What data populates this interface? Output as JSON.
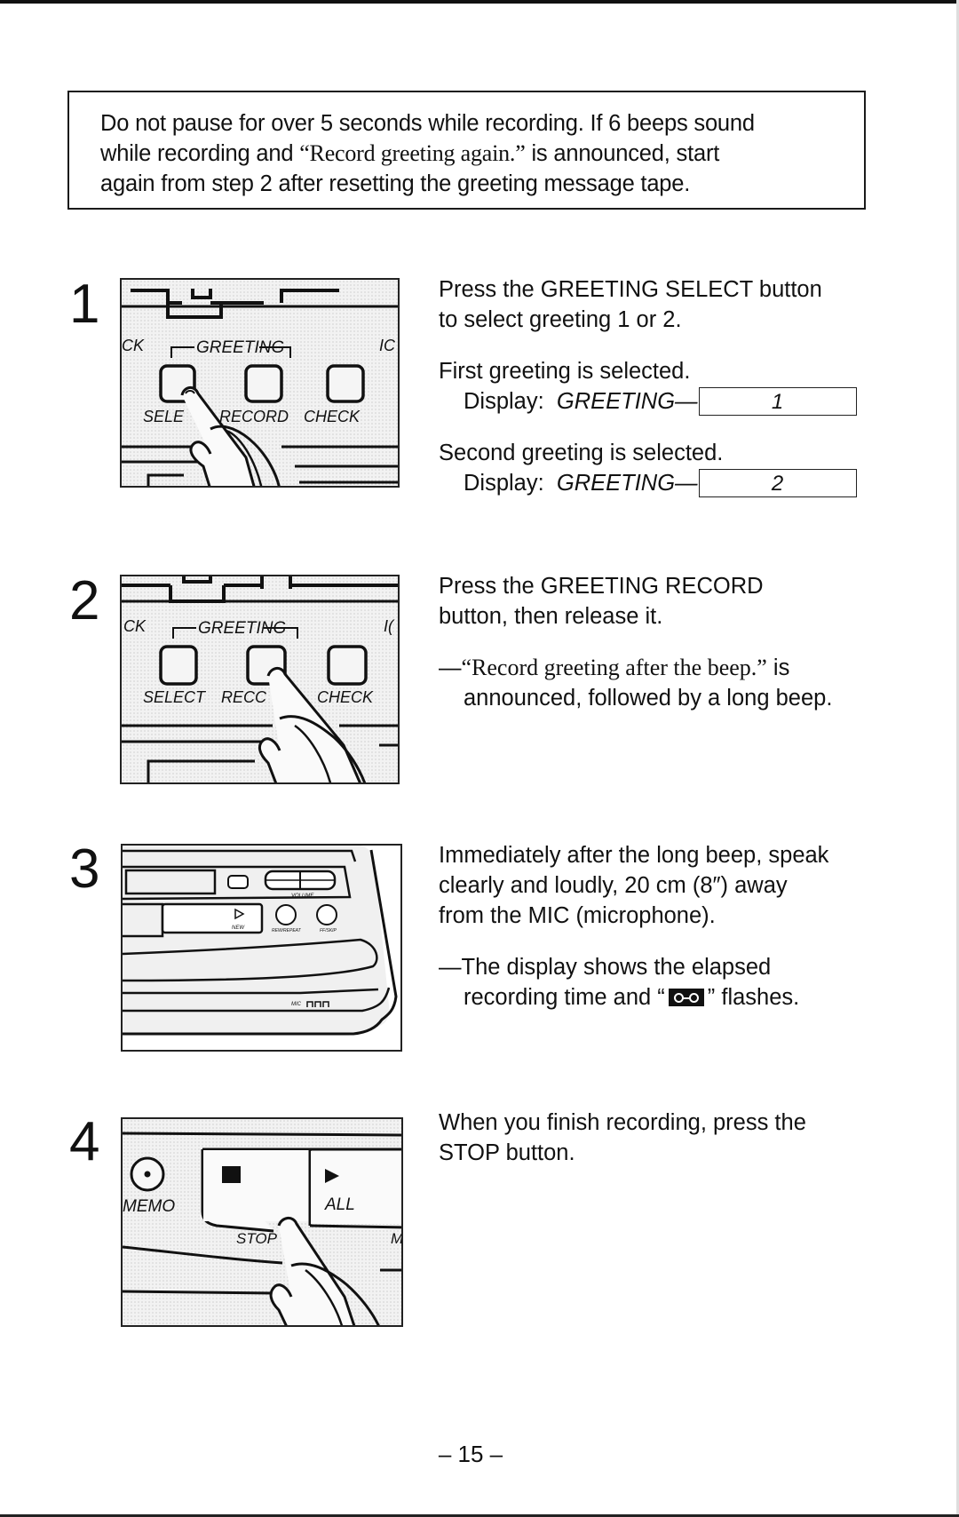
{
  "notice": {
    "line1": "Do not pause for over 5 seconds while recording. If 6 beeps sound",
    "line2_pre": "while recording and ",
    "line2_quote": "“Record greeting again.”",
    "line2_post": " is announced, start",
    "line3": "again from step 2 after resetting the greeting message tape."
  },
  "steps": [
    {
      "number": "1",
      "illustration": {
        "group_label": "GREETING",
        "left_edge_label": "CK",
        "right_edge_label": "IC",
        "buttons": [
          "SELE",
          "RECORD",
          "CHECK"
        ],
        "pressed": "SELECT"
      },
      "text_line1": "Press the GREETING SELECT button",
      "text_line2": "to select greeting 1 or 2.",
      "first_label": "First greeting is selected.",
      "second_label": "Second greeting is selected.",
      "display_prefix": "Display:",
      "display_word": "GREETING—",
      "display_values": [
        "1",
        "2"
      ]
    },
    {
      "number": "2",
      "illustration": {
        "group_label": "GREETING",
        "left_edge_label": "CK",
        "right_edge_label": "I(",
        "buttons": [
          "SELECT",
          "RECC",
          "CHECK"
        ],
        "pressed": "RECORD"
      },
      "text_line1": "Press the GREETING RECORD",
      "text_line2": "button, then release it.",
      "note_dash": "—",
      "note_quote": "“Record greeting after the beep.”",
      "note_post": " is",
      "note_line2": "announced, followed by a long beep."
    },
    {
      "number": "3",
      "illustration": {
        "labels": [
          "VOLUME",
          "NEW",
          "REW/REPEAT",
          "FF/SKIP",
          "MIC"
        ]
      },
      "text_line1": "Immediately after the long beep, speak",
      "text_line2": "clearly and loudly, 20 cm (8″) away",
      "text_line3": "from the MIC (microphone).",
      "note_line1": "—The display shows the elapsed",
      "note_line2_pre": "recording time and “",
      "note_icon": "cassette-tape-icon",
      "note_line2_post": "” flashes."
    },
    {
      "number": "4",
      "illustration": {
        "labels": [
          "MEMO",
          "STOP",
          "ALL",
          "M"
        ],
        "pressed": "STOP"
      },
      "text_line1": "When you finish recording, press the",
      "text_line2": "STOP button."
    }
  ],
  "page_number": "– 15 –"
}
